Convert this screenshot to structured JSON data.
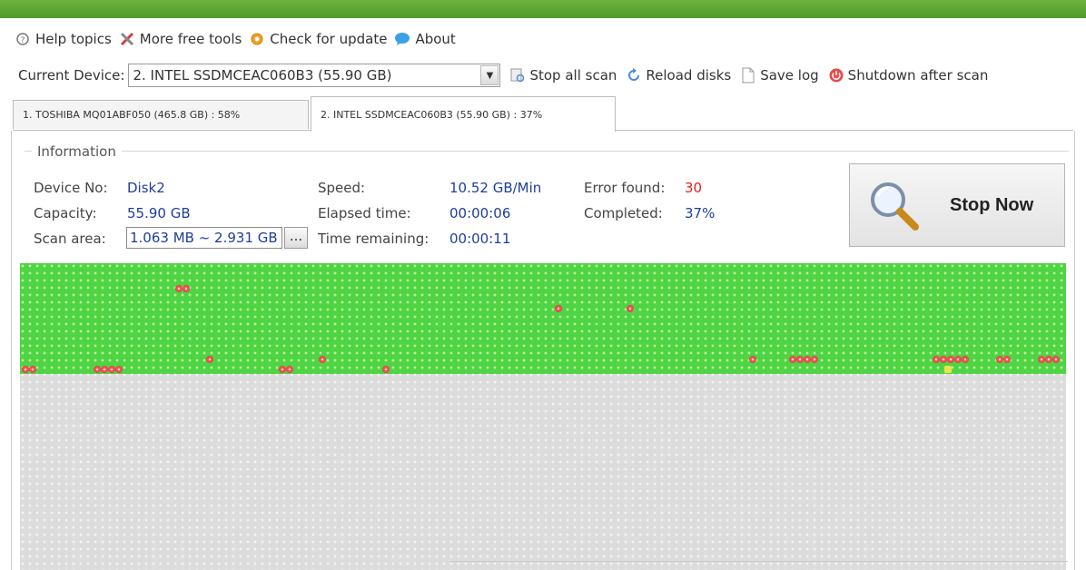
{
  "menu": {
    "help": "Help topics",
    "tools": "More free tools",
    "update": "Check for update",
    "about": "About"
  },
  "device": {
    "label": "Current Device:",
    "selected": "2. INTEL SSDMCEAC060B3  (55.90 GB)"
  },
  "toolbar": {
    "stop_all": "Stop all scan",
    "reload": "Reload disks",
    "save_log": "Save log",
    "shutdown": "Shutdown after scan"
  },
  "tabs": [
    {
      "label": "1. TOSHIBA MQ01ABF050  (465.8 GB) : 58%"
    },
    {
      "label": "2. INTEL SSDMCEAC060B3  (55.90 GB) : 37%"
    }
  ],
  "info": {
    "legend": "Information",
    "device_no_label": "Device No:",
    "device_no": "Disk2",
    "capacity_label": "Capacity:",
    "capacity": "55.90 GB",
    "scan_area_label": "Scan area:",
    "scan_area": "1.063 MB ~ 2.931 GB",
    "browse": "...",
    "speed_label": "Speed:",
    "speed": "10.52 GB/Min",
    "elapsed_label": "Elapsed time:",
    "elapsed": "00:00:06",
    "remaining_label": "Time remaining:",
    "remaining": "00:00:11",
    "error_label": "Error found:",
    "errors": "30",
    "completed_label": "Completed:",
    "completed": "37%"
  },
  "stop_button": "Stop Now",
  "colors": {
    "ok_block": "#4fd444",
    "error_block": "#f05a5a",
    "pending_block": "#dcdcdc",
    "value_text": "#1e3d9b",
    "error_text": "#e02020"
  }
}
